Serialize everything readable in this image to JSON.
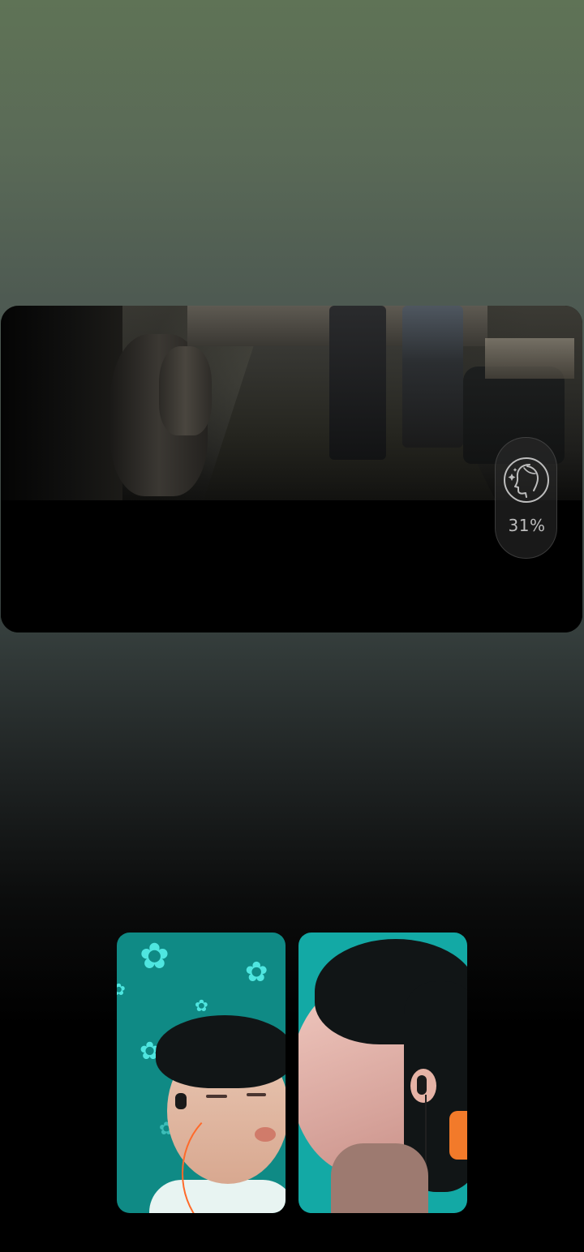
{
  "shared_video": {
    "label": "shared-screen-video"
  },
  "beauty_control": {
    "icon": "face-retouch-icon",
    "value": "31%"
  },
  "participants": [
    {
      "name": "",
      "icon": "participant-video"
    },
    {
      "name": "",
      "icon": "participant-video"
    }
  ],
  "colors": {
    "background_top": "#5f7356",
    "background_bottom": "#000000",
    "tile_teal": "#13a9a5",
    "control_text": "#bdbdbd"
  }
}
